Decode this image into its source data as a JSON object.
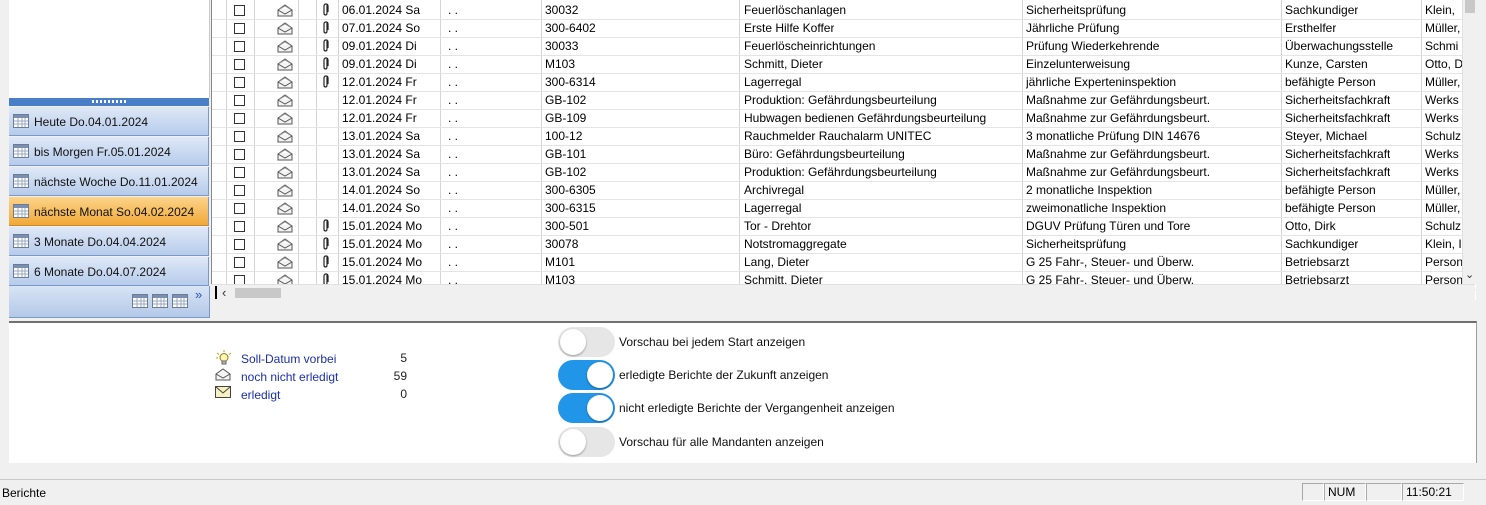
{
  "nav": {
    "items": [
      {
        "label": "Heute Do.04.01.2024",
        "active": false
      },
      {
        "label": "bis Morgen Fr.05.01.2024",
        "active": false
      },
      {
        "label": "nächste Woche Do.11.01.2024",
        "active": false
      },
      {
        "label": "nächste Monat So.04.02.2024",
        "active": true
      },
      {
        "label": "3 Monate Do.04.04.2024",
        "active": false
      },
      {
        "label": "6 Monate Do.04.07.2024",
        "active": false
      }
    ],
    "footer_icons": [
      "calendar-day-icon",
      "calendar-week-icon",
      "calendar-month-icon"
    ],
    "more_glyph": "»"
  },
  "grid": {
    "rows": [
      {
        "attach": true,
        "date": "06.01.2024 Sa",
        "extra": ". .",
        "id": "30032",
        "object": "Feuerlöschanlagen",
        "task": "Sicherheitsprüfung",
        "role": "Sachkundiger",
        "person": "Klein,"
      },
      {
        "attach": true,
        "date": "07.01.2024 So",
        "extra": ". .",
        "id": "300-6402",
        "object": "Erste Hilfe Koffer",
        "task": "Jährliche Prüfung",
        "role": "Ersthelfer",
        "person": "Müller,"
      },
      {
        "attach": true,
        "date": "09.01.2024 Di",
        "extra": ". .",
        "id": "30033",
        "object": "Feuerlöscheinrichtungen",
        "task": "Prüfung Wiederkehrende",
        "role": "Überwachungsstelle",
        "person": "Schmi"
      },
      {
        "attach": true,
        "date": "09.01.2024 Di",
        "extra": ". .",
        "id": "M103",
        "object": "Schmitt, Dieter",
        "task": "Einzelunterweisung",
        "role": "Kunze, Carsten",
        "person": "Otto, D"
      },
      {
        "attach": true,
        "date": "12.01.2024 Fr",
        "extra": ". .",
        "id": "300-6314",
        "object": "Lagerregal",
        "task": "jährliche Experteninspektion",
        "role": "befähigte Person",
        "person": "Müller,"
      },
      {
        "attach": false,
        "date": "12.01.2024 Fr",
        "extra": ". .",
        "id": "GB-102",
        "object": "Produktion: Gefährdungsbeurteilung",
        "task": "Maßnahme zur Gefährdungsbeurt.",
        "role": "Sicherheitsfachkraft",
        "person": "Werks"
      },
      {
        "attach": false,
        "date": "12.01.2024 Fr",
        "extra": ". .",
        "id": "GB-109",
        "object": "Hubwagen bedienen Gefährdungsbeurteilung",
        "task": "Maßnahme zur Gefährdungsbeurt.",
        "role": "Sicherheitsfachkraft",
        "person": "Werks"
      },
      {
        "attach": false,
        "date": "13.01.2024 Sa",
        "extra": ". .",
        "id": "100-12",
        "object": "Rauchmelder Rauchalarm UNITEC",
        "task": "3 monatliche Prüfung DIN 14676",
        "role": "Steyer, Michael",
        "person": "Schulz"
      },
      {
        "attach": false,
        "date": "13.01.2024 Sa",
        "extra": ". .",
        "id": "GB-101",
        "object": "Büro: Gefährdungsbeurteilung",
        "task": "Maßnahme zur Gefährdungsbeurt.",
        "role": "Sicherheitsfachkraft",
        "person": "Werks"
      },
      {
        "attach": false,
        "date": "13.01.2024 Sa",
        "extra": ". .",
        "id": "GB-102",
        "object": "Produktion: Gefährdungsbeurteilung",
        "task": "Maßnahme zur Gefährdungsbeurt.",
        "role": "Sicherheitsfachkraft",
        "person": "Werks"
      },
      {
        "attach": false,
        "date": "14.01.2024 So",
        "extra": ". .",
        "id": "300-6305",
        "object": "Archivregal",
        "task": "2 monatliche Inspektion",
        "role": "befähigte Person",
        "person": "Müller,"
      },
      {
        "attach": false,
        "date": "14.01.2024 So",
        "extra": ". .",
        "id": "300-6315",
        "object": "Lagerregal",
        "task": "zweimonatliche Inspektion",
        "role": "befähigte Person",
        "person": "Müller,"
      },
      {
        "attach": true,
        "date": "15.01.2024 Mo",
        "extra": ". .",
        "id": "300-501",
        "object": "Tor - Drehtor",
        "task": "DGUV Prüfung Türen und Tore",
        "role": "Otto, Dirk",
        "person": "Schulz"
      },
      {
        "attach": true,
        "date": "15.01.2024 Mo",
        "extra": ". .",
        "id": "30078",
        "object": "Notstromaggregate",
        "task": "Sicherheitsprüfung",
        "role": "Sachkundiger",
        "person": "Klein, I"
      },
      {
        "attach": true,
        "date": "15.01.2024 Mo",
        "extra": ". .",
        "id": "M101",
        "object": "Lang, Dieter",
        "task": "G 25 Fahr-, Steuer- und Überw.",
        "role": "Betriebsarzt",
        "person": "Person"
      },
      {
        "attach": true,
        "date": "15.01.2024 Mo",
        "extra": ". .",
        "id": "M103",
        "object": "Schmitt, Dieter",
        "task": "G 25 Fahr-, Steuer- und Überw.",
        "role": "Betriebsarzt",
        "person": "Person"
      }
    ]
  },
  "legend": [
    {
      "icon": "lightbulb-icon",
      "label": "Soll-Datum vorbei",
      "count": "5"
    },
    {
      "icon": "open-envelope-icon",
      "label": "noch nicht erledigt",
      "count": "59"
    },
    {
      "icon": "closed-envelope-icon",
      "label": "erledigt",
      "count": "0"
    }
  ],
  "toggles": [
    {
      "label": "Vorschau bei jedem Start anzeigen",
      "on": false
    },
    {
      "label": "erledigte Berichte der Zukunft anzeigen",
      "on": true
    },
    {
      "label": "nicht erledigte Berichte der Vergangenheit anzeigen",
      "on": true
    },
    {
      "label": "Vorschau für alle Mandanten anzeigen",
      "on": false
    }
  ],
  "statusbar": {
    "text": "Berichte",
    "num": "NUM",
    "time": "11:50:21"
  },
  "colors": {
    "nav_active": "#f1a838",
    "nav_button": "#b6cbeb",
    "toggle_on": "#2196e8",
    "legend_text": "#1b2fa8"
  }
}
